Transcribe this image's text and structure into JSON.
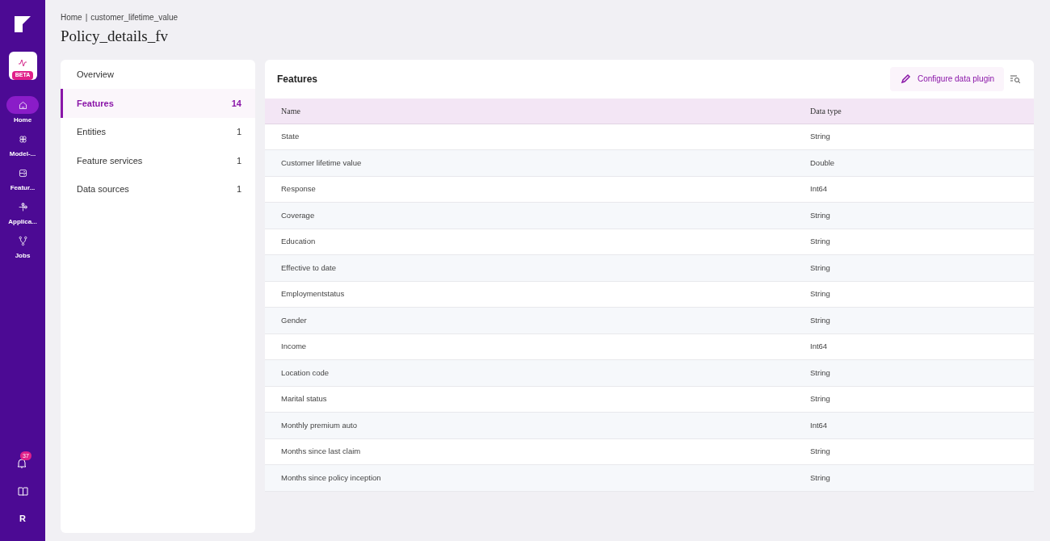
{
  "nav": {
    "items": [
      {
        "kind": "home",
        "label": "Home",
        "selected": true
      },
      {
        "kind": "models",
        "label": "Model-...",
        "selected": false
      },
      {
        "kind": "features",
        "label": "Featur...",
        "selected": false
      },
      {
        "kind": "apps",
        "label": "Applica...",
        "selected": false
      },
      {
        "kind": "jobs",
        "label": "Jobs",
        "selected": false
      }
    ],
    "beta_badge": "BETA",
    "notifications": "37",
    "user_initial": "R"
  },
  "breadcrumb": [
    "Home",
    "|",
    "customer_lifetime_value"
  ],
  "title": "Policy_details_fv",
  "menu": [
    {
      "label": "Overview",
      "selected": false
    },
    {
      "label": "Features",
      "count": "14",
      "selected": true
    },
    {
      "label": "Entities",
      "count": "1",
      "selected": false
    },
    {
      "label": "Feature services",
      "count": "1",
      "selected": false
    },
    {
      "label": "Data sources",
      "count": "1",
      "selected": false
    }
  ],
  "panel": {
    "title": "Features",
    "button": "Configure data plugin"
  },
  "table": {
    "columns": [
      "Name",
      "Data type"
    ],
    "rows": [
      [
        "State",
        "String"
      ],
      [
        "Customer lifetime value",
        "Double"
      ],
      [
        "Response",
        "Int64"
      ],
      [
        "Coverage",
        "String"
      ],
      [
        "Education",
        "String"
      ],
      [
        "Effective to date",
        "String"
      ],
      [
        "Employmentstatus",
        "String"
      ],
      [
        "Gender",
        "String"
      ],
      [
        "Income",
        "Int64"
      ],
      [
        "Location code",
        "String"
      ],
      [
        "Marital status",
        "String"
      ],
      [
        "Monthly premium auto",
        "Int64"
      ],
      [
        "Months since last claim",
        "String"
      ],
      [
        "Months since policy inception",
        "String"
      ]
    ]
  }
}
